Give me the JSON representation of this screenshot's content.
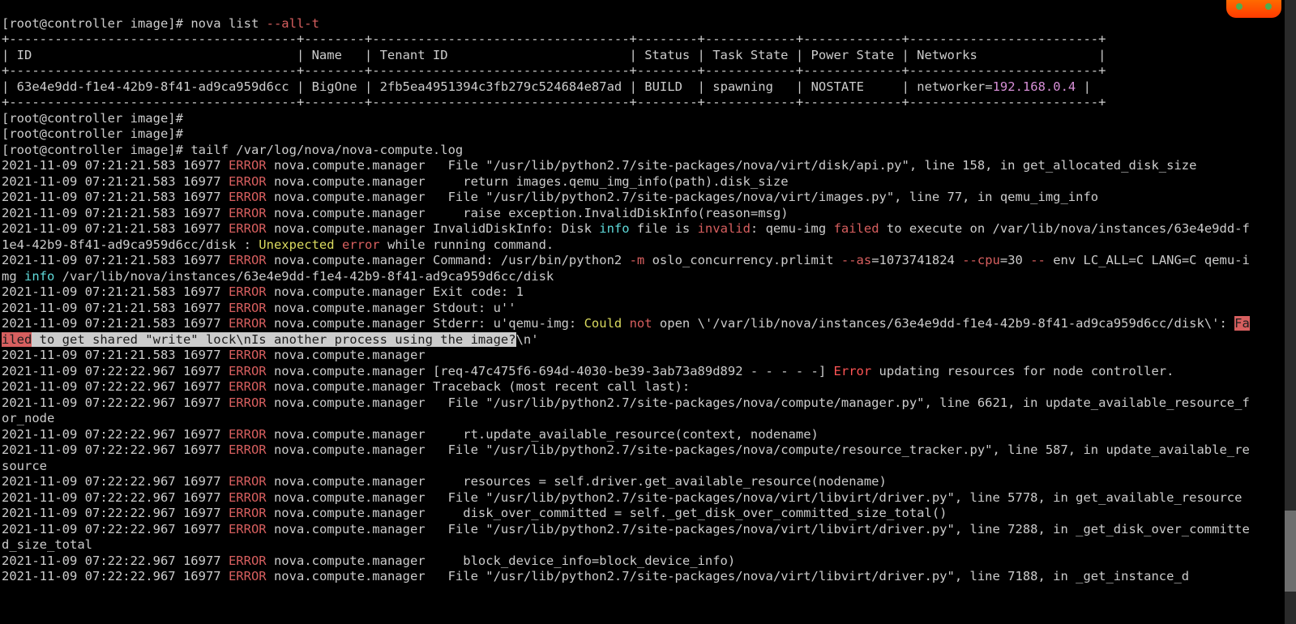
{
  "prompt": "[root@controller image]#",
  "cmd_nova": "nova list ",
  "cmd_nova_opt": "--all-t",
  "table": {
    "border_top": "+--------------------------------------+--------+----------------------------------+--------+------------+-------------+-------------------------+",
    "header": "| ID                                   | Name   | Tenant ID                        | Status | Task State | Power State | Networks                |",
    "row": {
      "id": "63e4e9dd-f1e4-42b9-8f41-ad9ca959d6cc",
      "name": "BigOne",
      "tenant": "2fb5ea4951394c3fb279c524684e87ad",
      "status": "BUILD",
      "task": "spawning",
      "power": "NOSTATE",
      "net_lbl": "networker",
      "net_ip": "192.168.0.4"
    }
  },
  "cmd_tailf": "tailf /var/log/nova/nova-compute.log",
  "log": {
    "ts1": "2021-11-09 07:21:21.583 16977 ",
    "ts2": "2021-11-09 07:22:22.967 16977 ",
    "err": "ERROR",
    "mod": " nova.compute.manager",
    "l1": "   File \"/usr/lib/python2.7/site-packages/nova/virt/disk/api.py\", line 158, in get_allocated_disk_size",
    "l2": "     return images.qemu_img_info(path).disk_size",
    "l3": "   File \"/usr/lib/python2.7/site-packages/nova/virt/images.py\", line 77, in qemu_img_info",
    "l4": "     raise exception.InvalidDiskInfo(reason=msg)",
    "l5a": " InvalidDiskInfo: Disk ",
    "l5b": "info",
    "l5c": " file is ",
    "l5d": "invalid",
    "l5e": ": qemu-img ",
    "l5f": "failed",
    "l5g": " to execute on /var/lib/nova/instances/63e4e9dd-f1e4-42b9-8f41-ad9ca959d6cc/disk : ",
    "l5h": "Unexpected",
    "l5i": " ",
    "l5j": "error",
    "l5k": " while running command.",
    "l6a": " Command: /usr/bin/python2 ",
    "l6b": "-m",
    "l6c": " oslo_concurrency.prlimit ",
    "l6d": "--as",
    "l6e": "=1073741824 ",
    "l6f": "--cpu",
    "l6g": "=30 ",
    "l6h": "--",
    "l6i": " env LC_ALL=C LANG=C qemu-img ",
    "l6j": "info",
    "l6k": " /var/lib/nova/instances/63e4e9dd-f1e4-42b9-8f41-ad9ca959d6cc/disk",
    "l7": " Exit code: 1",
    "l8": " Stdout: u''",
    "l9a": " Stderr: u'qemu-img: ",
    "l9b": "Could",
    "l9c": " ",
    "l9d": "not",
    "l9e": " open \\'/var/lib/nova/instances/63e4e9dd-f1e4-42b9-8f41-ad9ca959d6cc/disk\\': ",
    "l9f": "Failed",
    "l9g": " to get shared \"write\" lock\\nIs another process using the image?",
    "l9h": "\\n'",
    "l10": "",
    "l11a": " [req-47c475f6-694d-4030-be39-3ab73a89d892 - - - - -] ",
    "l11b": "Error",
    "l11c": " updating resources for node controller.",
    "l12": " Traceback (most recent call last):",
    "l13": "   File \"/usr/lib/python2.7/site-packages/nova/compute/manager.py\", line 6621, in update_available_resource_for_node",
    "l14": "     rt.update_available_resource(context, nodename)",
    "l15": "   File \"/usr/lib/python2.7/site-packages/nova/compute/resource_tracker.py\", line 587, in update_available_resource",
    "l16": "     resources = self.driver.get_available_resource(nodename)",
    "l17": "   File \"/usr/lib/python2.7/site-packages/nova/virt/libvirt/driver.py\", line 5778, in get_available_resource",
    "l18": "     disk_over_committed = self._get_disk_over_committed_size_total()",
    "l19": "   File \"/usr/lib/python2.7/site-packages/nova/virt/libvirt/driver.py\", line 7288, in _get_disk_over_committed_size_total",
    "l20": "     block_device_info=block_device_info)",
    "l21": "   File \"/usr/lib/python2.7/site-packages/nova/virt/libvirt/driver.py\", line 7188, in _get_instance_d"
  }
}
